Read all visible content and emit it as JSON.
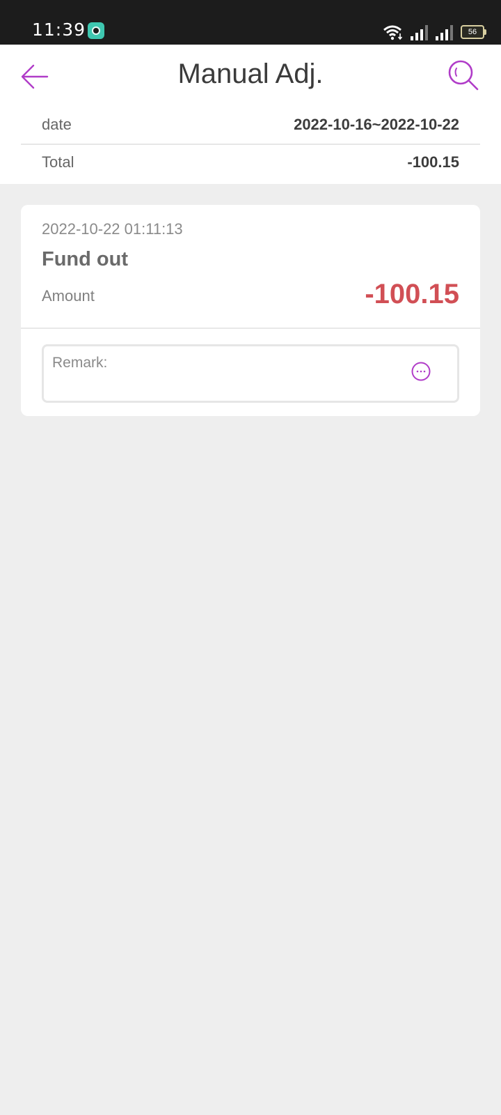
{
  "status_bar": {
    "time": "11:39",
    "battery": "56",
    "app_icon": "app-notification-icon",
    "wifi_icon": "wifi-icon",
    "signal_icon": "signal-icon"
  },
  "header": {
    "title": "Manual Adj.",
    "back_icon": "back-arrow-icon",
    "search_icon": "search-icon",
    "accent_color": "#b03cc8"
  },
  "summary": {
    "date_label": "date",
    "date_value": "2022-10-16~2022-10-22",
    "total_label": "Total",
    "total_value": "-100.15"
  },
  "records": [
    {
      "time": "2022-10-22 01:11:13",
      "type": "Fund out",
      "amount_label": "Amount",
      "amount_value": "-100.15",
      "amount_color": "#d14f55",
      "remark_label": "Remark:",
      "more_icon": "more-options-icon"
    }
  ]
}
